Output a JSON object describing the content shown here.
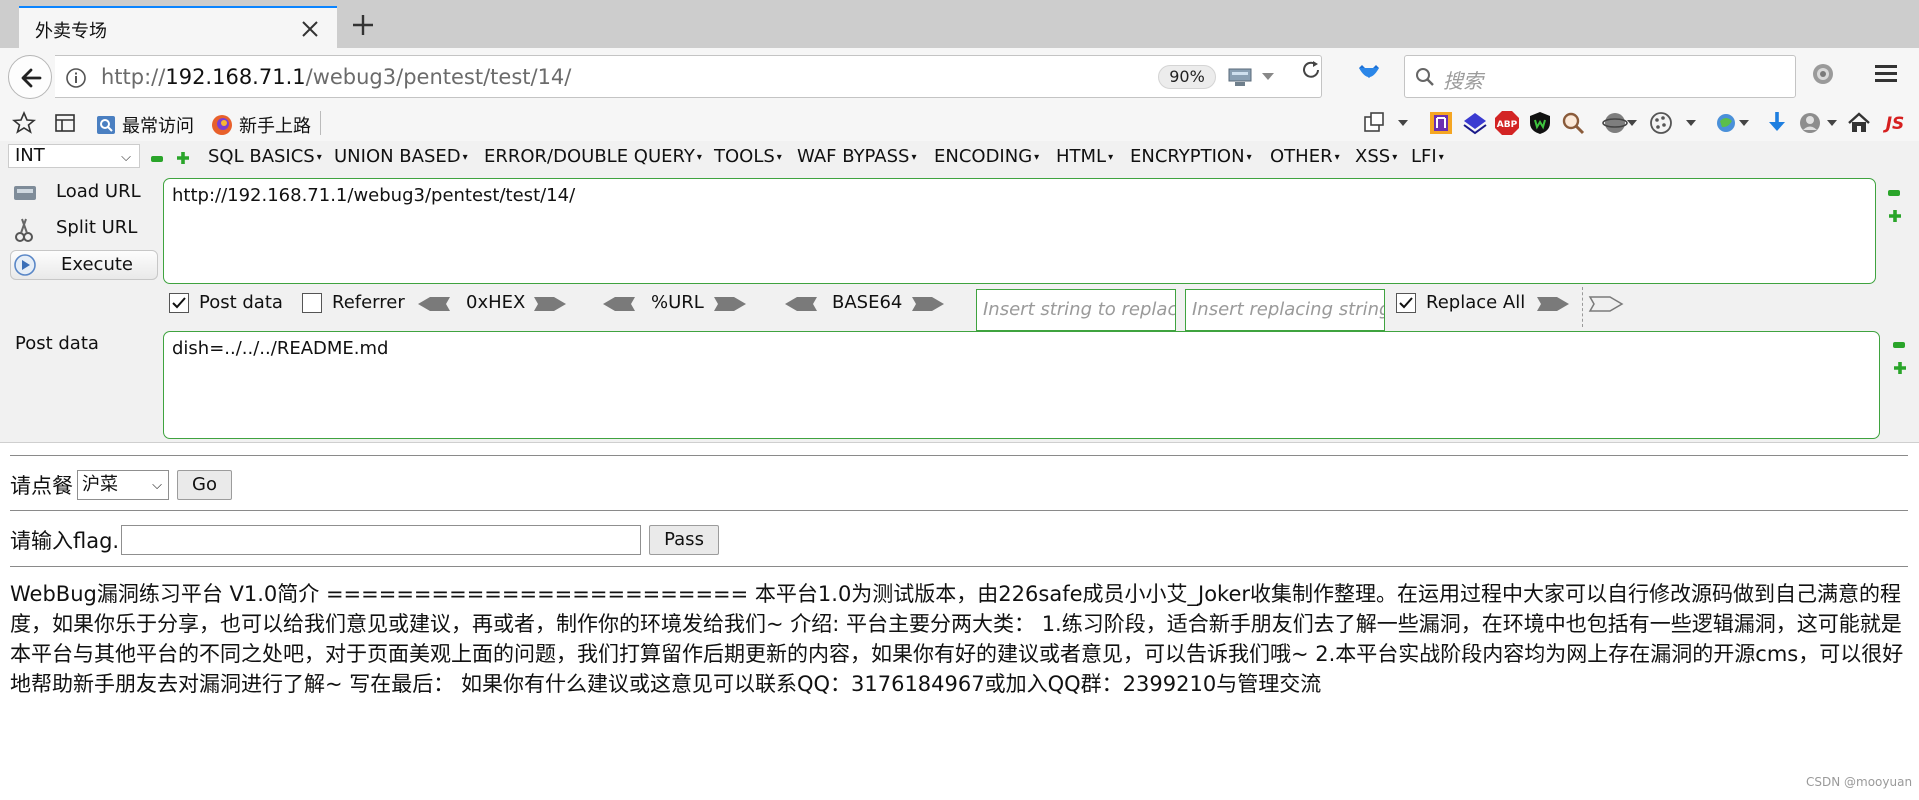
{
  "tab": {
    "title": "外卖专场"
  },
  "navbar": {
    "url_prefix": "http://",
    "url_host": "192.168.71.1",
    "url_path": "/webug3/pentest/test/14/",
    "zoom": "90%",
    "search_placeholder": "搜索"
  },
  "bookmarks": {
    "items": [
      {
        "label": "最常访问"
      },
      {
        "label": "新手上路"
      }
    ]
  },
  "hackbar": {
    "selector": "INT",
    "menus": [
      "SQL BASICS",
      "UNION BASED",
      "ERROR/DOUBLE QUERY",
      "TOOLS",
      "WAF BYPASS",
      "ENCODING",
      "HTML",
      "ENCRYPTION",
      "OTHER",
      "XSS",
      "LFI"
    ],
    "actions": {
      "load": "Load URL",
      "split": "Split URL",
      "execute": "Execute"
    },
    "url_value": "http://192.168.71.1/webug3/pentest/test/14/",
    "options": {
      "post_data": "Post data",
      "referrer": "Referrer",
      "hex": "0xHEX",
      "url": "%URL",
      "base64": "BASE64",
      "insert_placeholder": "Insert string to replace",
      "replacing_placeholder": "Insert replacing string",
      "replace_all": "Replace All"
    },
    "post_label": "Post data",
    "post_value": "dish=../../../README.md"
  },
  "page": {
    "order_label": "请点餐",
    "order_selected": "沪菜",
    "go_label": "Go",
    "flag_label": "请输入flag.",
    "pass_label": "Pass",
    "intro": "WebBug漏洞练习平台 V1.0简介 ======================== 本平台1.0为测试版本，由226safe成员小小艾_Joker收集制作整理。在运用过程中大家可以自行修改源码做到自己满意的程度，如果你乐于分享，也可以给我们意见或建议，再或者，制作你的环境发给我们~ 介绍: 平台主要分两大类： 1.练习阶段，适合新手朋友们去了解一些漏洞，在环境中也包括有一些逻辑漏洞，这可能就是本平台与其他平台的不同之处吧，对于页面美观上面的问题，我们打算留作后期更新的内容，如果你有好的建议或者意见，可以告诉我们哦~ 2.本平台实战阶段内容均为网上存在漏洞的开源cms，可以很好地帮助新手朋友去对漏洞进行了解~ 写在最后： 如果你有什么建议或这意见可以联系QQ：3176184967或加入QQ群：2399210与管理交流"
  },
  "watermark": "CSDN @mooyuan",
  "colors": {
    "accent_green": "#3fa33f",
    "tab_blue": "#0a84ff"
  }
}
